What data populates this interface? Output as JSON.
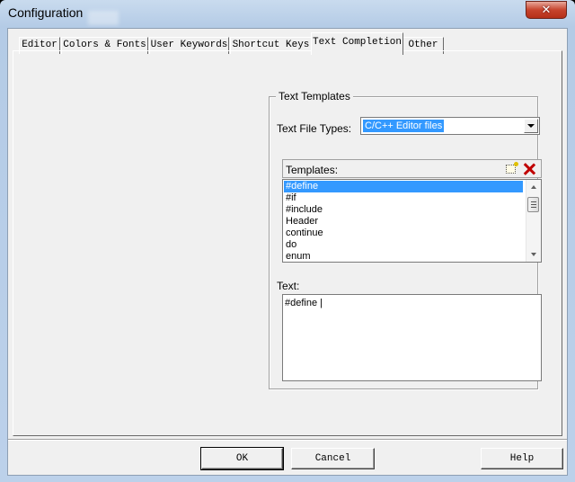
{
  "window": {
    "title": "Configuration",
    "close_glyph": "✕"
  },
  "tabs": [
    {
      "label": "Editor",
      "active": false
    },
    {
      "label": "Colors & Fonts",
      "active": false
    },
    {
      "label": "User Keywords",
      "active": false
    },
    {
      "label": "Shortcut Keys",
      "active": false
    },
    {
      "label": "Text Completion",
      "active": true
    },
    {
      "label": "Other",
      "active": false
    }
  ],
  "text_templates": {
    "group_label": "Text Templates",
    "file_types_label": "Text File Types:",
    "file_types_value": "C/C++ Editor files",
    "templates_label": "Templates:",
    "templates": [
      "#define",
      "#if",
      "#include",
      "Header",
      "continue",
      "do",
      "enum"
    ],
    "selected_template": "#define",
    "text_label": "Text:",
    "text_value": "#define |",
    "icons": {
      "new": "new-template-icon",
      "delete": "delete-template-icon"
    }
  },
  "buttons": {
    "ok": "OK",
    "cancel": "Cancel",
    "help": "Help"
  }
}
